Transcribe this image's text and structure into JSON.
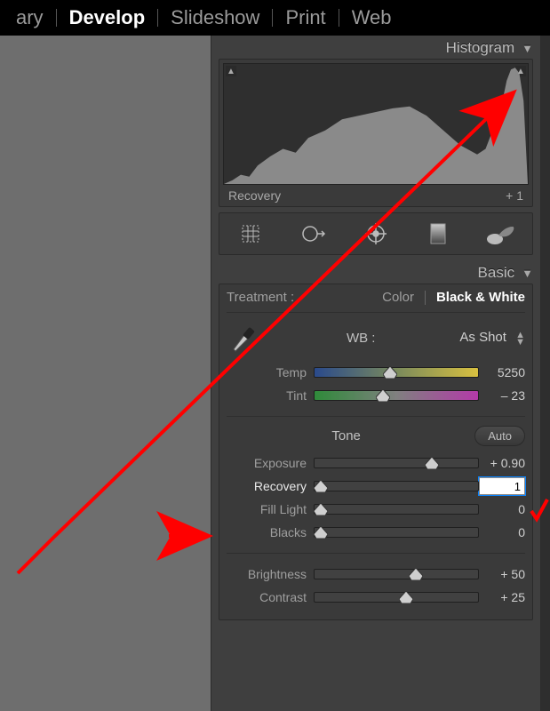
{
  "tabs": {
    "library": "ary",
    "develop": "Develop",
    "slideshow": "Slideshow",
    "print": "Print",
    "web": "Web",
    "active": "develop"
  },
  "histogram": {
    "title": "Histogram",
    "status_label": "Recovery",
    "status_value": "+ 1"
  },
  "basic": {
    "title": "Basic",
    "treatment_label": "Treatment :",
    "treatment_color": "Color",
    "treatment_bw": "Black & White",
    "wb_label": "WB :",
    "wb_selected": "As Shot",
    "temp_label": "Temp",
    "temp_value": "5250",
    "tint_label": "Tint",
    "tint_value": "– 23",
    "tone_label": "Tone",
    "auto_label": "Auto",
    "exposure_label": "Exposure",
    "exposure_value": "+ 0.90",
    "recovery_label": "Recovery",
    "recovery_value": "1",
    "fill_label": "Fill Light",
    "fill_value": "0",
    "blacks_label": "Blacks",
    "blacks_value": "0",
    "brightness_label": "Brightness",
    "brightness_value": "+ 50",
    "contrast_label": "Contrast",
    "contrast_value": "+ 25"
  }
}
